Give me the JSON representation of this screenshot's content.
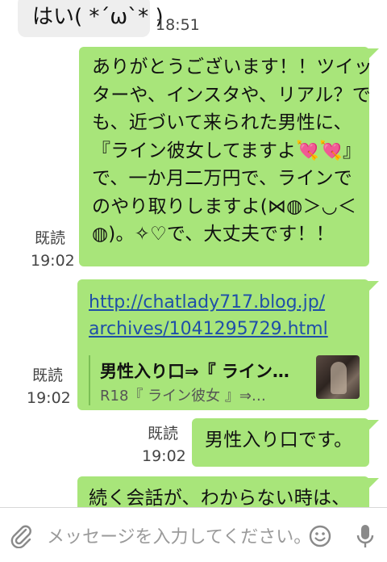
{
  "messages": {
    "incoming_1": {
      "text": "はい( *´ω`* )",
      "time": "18:51"
    },
    "outgoing_1": {
      "lines": [
        "ありがとうございます！！ツイッ",
        "ターや、インスタや、リアル？で",
        "も、近づいて来られた男性に、",
        "『ライン彼女してますよ💘💘』",
        "で、一か月二万円で、ラインで",
        "のやり取りしますよ(⋈◍＞◡＜",
        "◍)。✧♡で、大丈夫です！！"
      ],
      "read": "既読",
      "time": "19:02"
    },
    "outgoing_2": {
      "link_lines": [
        "http://chatlady717.blog.jp/",
        "archives/1041295729.html"
      ],
      "preview_title": "男性入り口⇒『 ライン…",
      "preview_subtitle": "R18『 ライン彼女 』⇒…",
      "read": "既読",
      "time": "19:02"
    },
    "outgoing_3": {
      "text": "男性入り口です。",
      "read": "既読",
      "time": "19:02"
    },
    "outgoing_4": {
      "text": "続く会話が、わからない時は、"
    }
  },
  "input_bar": {
    "placeholder": "メッセージを入力してください。",
    "icons": [
      "attach-icon",
      "emoji-icon",
      "microphone-icon"
    ]
  },
  "colors": {
    "outgoing_bubble": "#a8e57a",
    "incoming_bubble": "#eeeeee",
    "link": "#1f4fa8"
  }
}
